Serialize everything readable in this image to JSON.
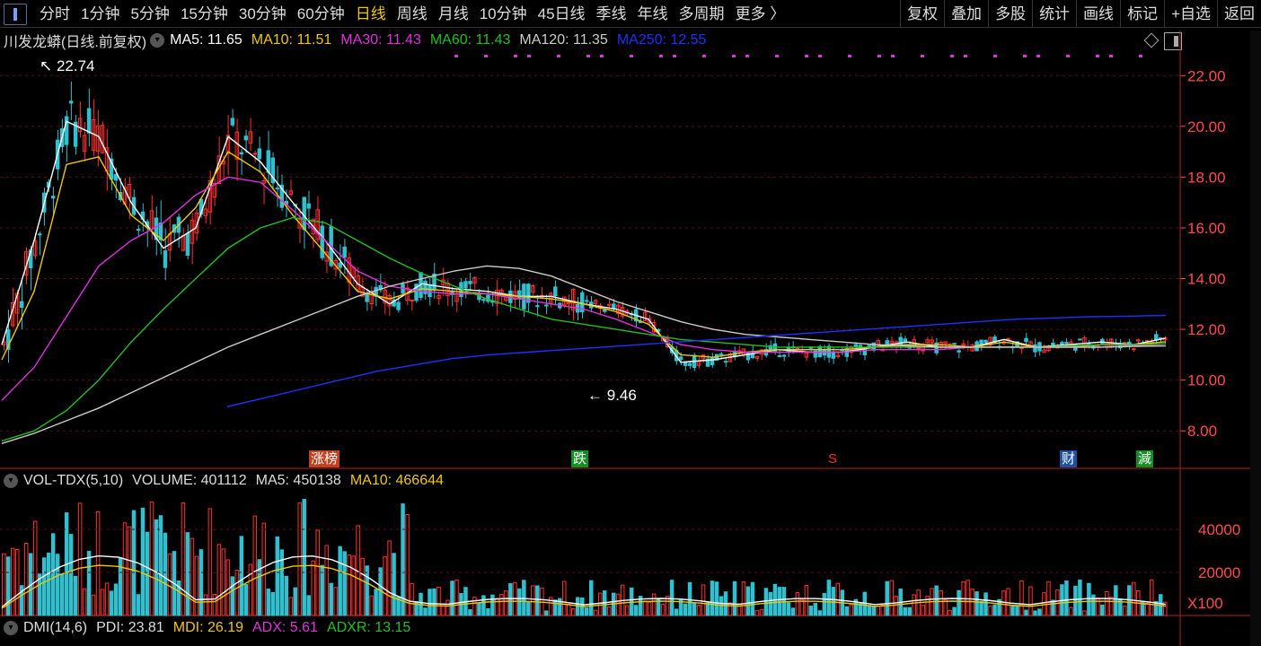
{
  "toolbar": {
    "periods": [
      "分时",
      "1分钟",
      "5分钟",
      "15分钟",
      "30分钟",
      "60分钟",
      "日线",
      "周线",
      "月线",
      "10分钟",
      "45日线",
      "季线",
      "年线",
      "多周期",
      "更多 〉"
    ],
    "active_period": "日线",
    "right_tools": [
      "复权",
      "叠加",
      "多股",
      "统计",
      "画线",
      "标记",
      "+自选",
      "返回"
    ]
  },
  "stock": {
    "title": "川发龙蟒(日线.前复权)",
    "ma": [
      {
        "label": "MA5: 11.65",
        "color": "#ffffff"
      },
      {
        "label": "MA10: 11.51",
        "color": "#f0c800"
      },
      {
        "label": "MA30: 11.43",
        "color": "#e030e0"
      },
      {
        "label": "MA60: 11.43",
        "color": "#20c020"
      },
      {
        "label": "MA120: 11.35",
        "color": "#cccccc"
      },
      {
        "label": "MA250: 12.55",
        "color": "#2030ff"
      }
    ]
  },
  "price_axis": [
    "22.00",
    "20.00",
    "18.00",
    "16.00",
    "14.00",
    "12.00",
    "10.00",
    "8.00"
  ],
  "annotations": {
    "high": "22.74",
    "low": "9.46"
  },
  "events": [
    {
      "text": "涨榜",
      "bg": "#c04020"
    },
    {
      "text": "跌",
      "bg": "#109020"
    },
    {
      "text": "S",
      "bg": "#000000",
      "color": "#ff3030"
    },
    {
      "text": "财",
      "bg": "#2050a0"
    },
    {
      "text": "減",
      "bg": "#109020"
    }
  ],
  "volume": {
    "label": "VOL-TDX(5,10)",
    "volume": "VOLUME: 401112",
    "ma5": "MA5: 450138",
    "ma10": "MA10: 466644",
    "axis": [
      "40000",
      "20000"
    ],
    "unit": "X100"
  },
  "dmi": {
    "label": "DMI(14,6)",
    "pdi": "PDI: 23.81",
    "mdi": "MDI: 26.19",
    "adx": "ADX: 5.61",
    "adxr": "ADXR: 13.15"
  },
  "chart_data": {
    "type": "candlestick",
    "price_range": [
      7.3,
      23.0
    ],
    "ma_series": [
      {
        "name": "MA5",
        "color": "#ffffff",
        "values": [
          11.4,
          15.5,
          20.2,
          19.6,
          17.0,
          15.2,
          16.0,
          19.6,
          18.6,
          17.0,
          15.5,
          13.8,
          13.0,
          13.8,
          13.6,
          13.5,
          13.3,
          13.3,
          13.0,
          12.8,
          12.4,
          10.7,
          10.8,
          11.0,
          11.2,
          11.1,
          11.1,
          11.3,
          11.5,
          11.3,
          11.3,
          11.6,
          11.3,
          11.4,
          11.5,
          11.4,
          11.65
        ]
      },
      {
        "name": "MA10",
        "color": "#f0c800",
        "values": [
          10.8,
          13.5,
          18.5,
          18.8,
          16.5,
          15.5,
          16.8,
          19.0,
          18.2,
          16.5,
          15.0,
          13.5,
          13.2,
          13.6,
          13.5,
          13.4,
          13.3,
          13.2,
          13.0,
          12.7,
          12.2,
          11.0,
          10.9,
          11.1,
          11.2,
          11.2,
          11.2,
          11.3,
          11.4,
          11.4,
          11.3,
          11.5,
          11.3,
          11.3,
          11.4,
          11.4,
          11.51
        ]
      },
      {
        "name": "MA30",
        "color": "#e030e0",
        "values": [
          9.2,
          10.5,
          12.5,
          14.5,
          15.5,
          16.2,
          17.3,
          18.0,
          17.8,
          16.7,
          15.5,
          14.3,
          13.7,
          13.5,
          13.4,
          13.4,
          13.2,
          13.0,
          12.8,
          12.4,
          11.9,
          11.4,
          11.2,
          11.1,
          11.1,
          11.1,
          11.1,
          11.2,
          11.2,
          11.2,
          11.3,
          11.3,
          11.3,
          11.3,
          11.3,
          11.35,
          11.43
        ]
      },
      {
        "name": "MA60",
        "color": "#20c020",
        "values": [
          7.6,
          8.0,
          8.8,
          10.0,
          11.5,
          12.8,
          14.0,
          15.2,
          16.0,
          16.4,
          16.2,
          15.5,
          14.8,
          14.2,
          13.7,
          13.2,
          12.8,
          12.4,
          12.2,
          12.0,
          11.8,
          11.6,
          11.5,
          11.4,
          11.3,
          11.3,
          11.3,
          11.3,
          11.3,
          11.3,
          11.3,
          11.3,
          11.3,
          11.35,
          11.4,
          11.4,
          11.43
        ]
      },
      {
        "name": "MA120",
        "color": "#cccccc",
        "values": [
          7.5,
          7.9,
          8.4,
          8.9,
          9.5,
          10.1,
          10.7,
          11.3,
          11.8,
          12.3,
          12.8,
          13.3,
          13.7,
          14.0,
          14.3,
          14.5,
          14.4,
          14.1,
          13.6,
          13.1,
          12.7,
          12.3,
          12.0,
          11.8,
          11.7,
          11.6,
          11.5,
          11.4,
          11.35,
          11.3,
          11.3,
          11.3,
          11.3,
          11.3,
          11.3,
          11.33,
          11.35
        ]
      },
      {
        "name": "MA250",
        "color": "#2030ff",
        "values": [
          null,
          null,
          null,
          null,
          null,
          null,
          8.95,
          9.3,
          9.65,
          10.0,
          10.35,
          10.6,
          10.85,
          11.0,
          11.1,
          11.2,
          11.3,
          11.4,
          11.5,
          11.6,
          11.7,
          11.8,
          11.9,
          12.0,
          12.1,
          12.2,
          12.3,
          12.4,
          12.45,
          12.5,
          12.52,
          12.55
        ]
      }
    ],
    "volume_ma_max": 50000
  }
}
